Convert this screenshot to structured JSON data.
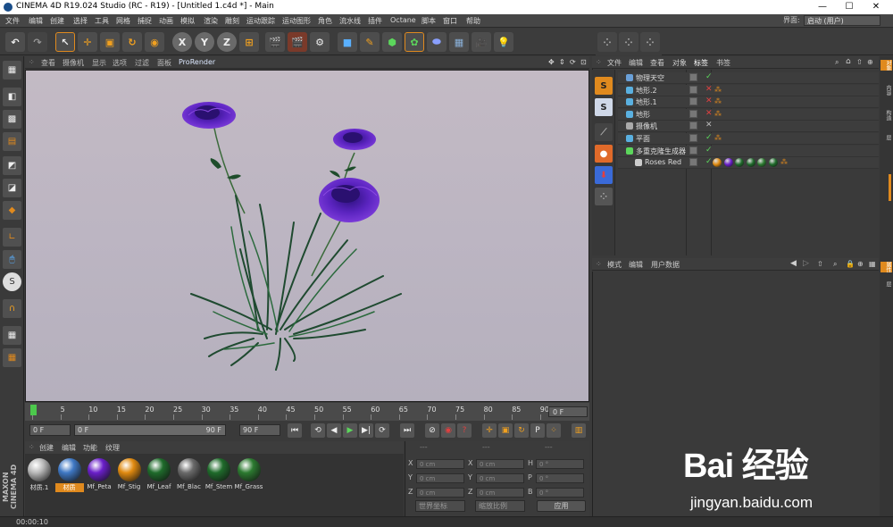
{
  "window": {
    "title": "CINEMA 4D R19.024 Studio (RC - R19) - [Untitled 1.c4d *] - Main",
    "minimize": "—",
    "maximize": "☐",
    "close": "✕"
  },
  "menubar": {
    "items": [
      "文件",
      "编辑",
      "创建",
      "选择",
      "工具",
      "网格",
      "捕捉",
      "动画",
      "模拟",
      "渲染",
      "雕刻",
      "运动跟踪",
      "运动图形",
      "角色",
      "流水线",
      "插件",
      "Octane",
      "脚本",
      "窗口",
      "帮助"
    ],
    "interface_label": "界面:",
    "interface_value": "启动 (用户)"
  },
  "toolbar": {
    "axis_x": "X",
    "axis_y": "Y",
    "axis_z": "Z"
  },
  "viewport": {
    "menu": [
      "查看",
      "摄像机",
      "显示",
      "选项",
      "过滤",
      "面板",
      "ProRender"
    ]
  },
  "timeline": {
    "ticks": [
      "0",
      "5",
      "10",
      "15",
      "20",
      "25",
      "30",
      "35",
      "40",
      "45",
      "50",
      "55",
      "60",
      "65",
      "70",
      "75",
      "80",
      "85",
      "90"
    ],
    "current": "0 F"
  },
  "playbar": {
    "start": "0 F",
    "range_start": "0 F",
    "range_end": "90 F",
    "end": "90 F"
  },
  "materials": {
    "menu": [
      "创建",
      "编辑",
      "功能",
      "纹理"
    ],
    "items": [
      {
        "name": "材质.1",
        "color": "#b9b9b9"
      },
      {
        "name": "材质",
        "color": "#3f78c4"
      },
      {
        "name": "Mf_Peta",
        "color": "#6a1fc9"
      },
      {
        "name": "Mf_Stig",
        "color": "#e08a10"
      },
      {
        "name": "Mf_Leaf",
        "color": "#1f6b2b"
      },
      {
        "name": "Mf_Blac",
        "color": "#6a6a6a"
      },
      {
        "name": "Mf_Stem",
        "color": "#1f6b2b"
      },
      {
        "name": "Mf_Grass",
        "color": "#2c7a30"
      }
    ]
  },
  "coords": {
    "header": [
      "---",
      "---",
      "---"
    ],
    "rows": [
      {
        "a": "X",
        "av": "0 cm",
        "b": "X",
        "bv": "0 cm",
        "c": "H",
        "cv": "0 °"
      },
      {
        "a": "Y",
        "av": "0 cm",
        "b": "Y",
        "bv": "0 cm",
        "c": "P",
        "cv": "0 °"
      },
      {
        "a": "Z",
        "av": "0 cm",
        "b": "Z",
        "bv": "0 cm",
        "c": "B",
        "cv": "0 °"
      }
    ],
    "world": "世界坐标",
    "scale": "缩放比例",
    "apply": "应用"
  },
  "status": {
    "time": "00:00:10"
  },
  "objects": {
    "menu": [
      "文件",
      "编辑",
      "查看",
      "对象",
      "标签",
      "书签"
    ],
    "rows": [
      {
        "name": "物理天空",
        "icon": "#6aa0d8",
        "check": "✓",
        "checkcolor": "#5cd65c",
        "tag": ""
      },
      {
        "name": "地形.2",
        "icon": "#5ab0e0",
        "check": "✕",
        "checkcolor": "#e04040",
        "tag": "⁂"
      },
      {
        "name": "地形.1",
        "icon": "#5ab0e0",
        "check": "✕",
        "checkcolor": "#e04040",
        "tag": "⁂"
      },
      {
        "name": "地形",
        "icon": "#5ab0e0",
        "check": "✕",
        "checkcolor": "#e04040",
        "tag": "⁂"
      },
      {
        "name": "摄像机",
        "icon": "#aaaaaa",
        "check": "✕",
        "checkcolor": "#bbbbbb",
        "tag": ""
      },
      {
        "name": "平面",
        "icon": "#5ab0e0",
        "check": "✓",
        "checkcolor": "#5cd65c",
        "tag": "⁂"
      },
      {
        "name": "多重克隆生成器",
        "icon": "#5cd65c",
        "check": "✓",
        "checkcolor": "#5cd65c",
        "tag": ""
      },
      {
        "name": "Roses Red",
        "icon": "#cccccc",
        "check": "✓",
        "checkcolor": "#5cd65c",
        "tag": ""
      }
    ]
  },
  "attributes": {
    "menu": [
      "模式",
      "编辑",
      "用户数据"
    ]
  },
  "right_tabs": [
    "对象",
    "内容",
    "构造",
    "层"
  ],
  "right_tabs2": [
    "属性",
    "层"
  ],
  "branding": {
    "maxon": "MAXON CINEMA 4D"
  },
  "watermark": {
    "logo": "Bai 经验",
    "url": "jingyan.baidu.com"
  }
}
